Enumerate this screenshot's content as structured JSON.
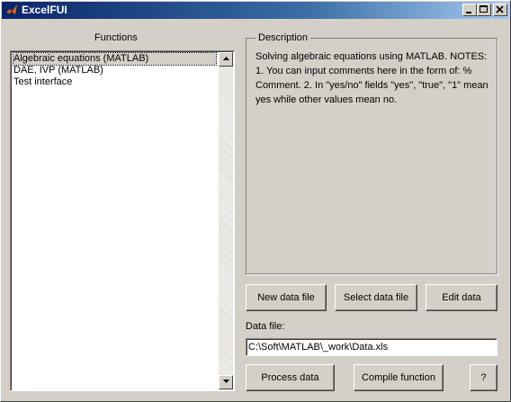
{
  "window": {
    "title": "ExcelFUI"
  },
  "functions": {
    "label": "Functions",
    "items": [
      {
        "label": "Algebraic equations (MATLAB)",
        "selected": true
      },
      {
        "label": "DAE, IVP (MATLAB)",
        "selected": false
      },
      {
        "label": "Test interface",
        "selected": false
      }
    ]
  },
  "description": {
    "legend": "Description",
    "lines": [
      "Solving algebraic equations using MATLAB.  NOTES:",
      "1. You can input comments here in the form of: %",
      "Comment. 2. In \"yes/no\" fields \"yes\", \"true\", \"1\" mean",
      "yes while other values mean no."
    ]
  },
  "buttons": {
    "new_data_file": "New data file",
    "select_data_file": "Select data file",
    "edit_data": "Edit data",
    "process_data": "Process data",
    "compile_function": "Compile function",
    "help": "?"
  },
  "data_file": {
    "label": "Data file:",
    "value": "C:\\Soft\\MATLAB\\_work\\Data.xls"
  },
  "icons": {
    "app": "matlab-logo-icon",
    "minimize": "minimize-icon",
    "maximize": "maximize-icon",
    "close": "close-icon",
    "scroll_up": "arrow-up-icon",
    "scroll_down": "arrow-down-icon"
  },
  "colors": {
    "titlebar_start": "#0a246a",
    "titlebar_end": "#a6caf0",
    "face": "#d4d0c8"
  }
}
